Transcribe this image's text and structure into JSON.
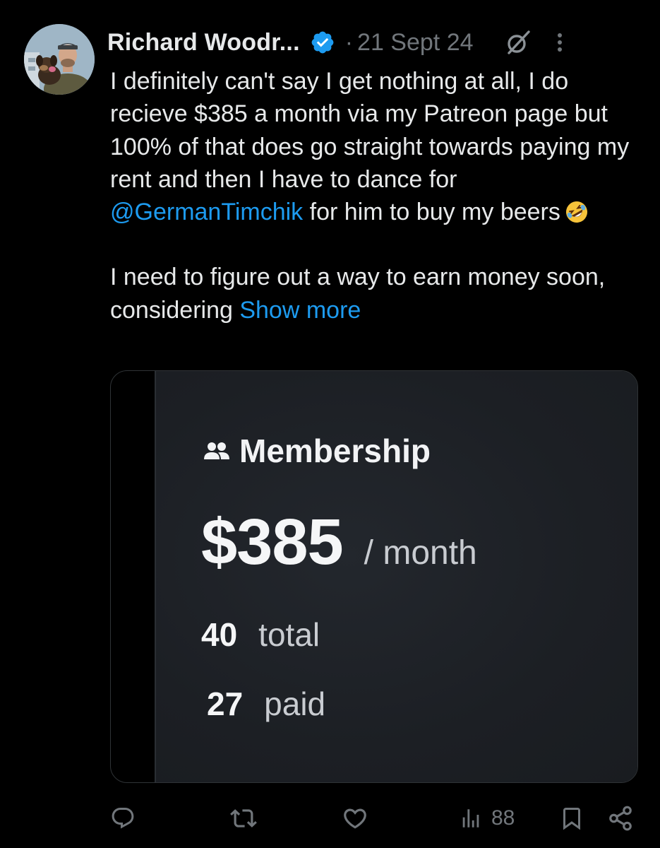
{
  "author": {
    "name": "Richard Woodr...",
    "date": "21 Sept 24",
    "separator": "·"
  },
  "tweet": {
    "paragraph1_before": "I definitely can't say I get nothing at all, I do recieve $385 a month via my Patreon page but 100% of that does go straight towards paying my rent and then I have to dance for ",
    "mention": "@GermanTimchik",
    "paragraph1_after": " for him to buy my beers",
    "emoji": "rolling-on-floor-laughing",
    "paragraph2": "I need to figure out a way to earn money soon, considering ",
    "show_more": "Show more"
  },
  "media": {
    "title": "Membership",
    "amount": "$385",
    "period": "/ month",
    "total_value": "40",
    "total_label": "total",
    "paid_value": "27",
    "paid_label": "paid"
  },
  "actions": {
    "views": "88"
  },
  "colors": {
    "background": "#000000",
    "text": "#e7e9ea",
    "muted": "#71767b",
    "accent": "#1d9bf0"
  },
  "icons": [
    "avatar",
    "verified-icon",
    "grok-icon",
    "more-icon",
    "reply-icon",
    "retweet-icon",
    "like-icon",
    "views-icon",
    "bookmark-icon",
    "share-icon",
    "members-icon"
  ]
}
